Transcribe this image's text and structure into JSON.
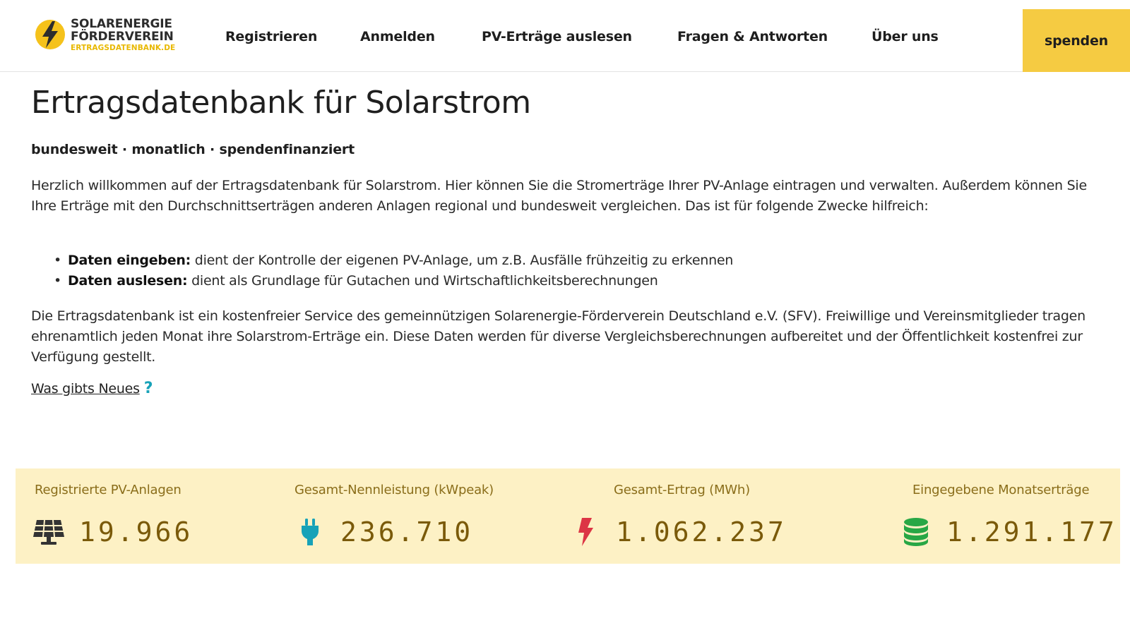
{
  "logo": {
    "line1": "SOLARENERGIE",
    "line2": "FÖRDERVEREIN",
    "line3": "ERTRAGSDATENBANK.DE",
    "icon": "sun-bolt-icon"
  },
  "nav": {
    "items": [
      {
        "label": "Registrieren"
      },
      {
        "label": "Anmelden"
      },
      {
        "label": "PV-Erträge auslesen"
      },
      {
        "label": "Fragen & Antworten"
      },
      {
        "label": "Über uns"
      }
    ],
    "donate_label": "spenden"
  },
  "main": {
    "title": "Ertragsdatenbank für Solarstrom",
    "tagline": "bundesweit · monatlich · spendenfinanziert",
    "intro": "Herzlich willkommen auf der Ertragsdatenbank für Solarstrom. Hier können Sie die Stromerträge Ihrer PV-Anlage eintragen und verwalten. Außerdem können Sie Ihre Erträge mit den Durchschnittserträgen anderen Anlagen regional und bundesweit vergleichen. Das ist für folgende Zwecke hilfreich:",
    "bullets": [
      {
        "bold": "Daten eingeben:",
        "text": " dient der Kontrolle der eigenen PV-Anlage, um z.B. Ausfälle frühzeitig zu erkennen"
      },
      {
        "bold": "Daten auslesen:",
        "text": " dient als Grundlage für Gutachen und Wirtschaftlichkeitsberechnungen"
      }
    ],
    "about": "Die Ertragsdatenbank ist ein kostenfreier Service des gemeinnützigen Solarenergie-Förderverein Deutschland e.V. (SFV). Freiwillige und Vereinsmitglieder tragen ehrenamtlich jeden Monat ihre Solarstrom-Erträge ein. Diese Daten werden für diverse Vergleichsberechnungen aufbereitet und der Öffentlichkeit kostenfrei zur Verfügung gestellt.",
    "news_link": "Was gibts Neues",
    "news_icon": "?"
  },
  "stats": [
    {
      "label": "Registrierte PV-Anlagen",
      "value": "19.966",
      "icon": "solar-panel-icon",
      "color": "#333333"
    },
    {
      "label": "Gesamt-Nennleistung (kWpeak)",
      "value": "236.710",
      "icon": "plug-icon",
      "color": "#17a2b8"
    },
    {
      "label": "Gesamt-Ertrag (MWh)",
      "value": "1.062.237",
      "icon": "lightning-bolt-icon",
      "color": "#dc3545"
    },
    {
      "label": "Eingegebene Monatserträge",
      "value": "1.291.177",
      "icon": "database-icon",
      "color": "#28a745"
    }
  ],
  "colors": {
    "accent": "#f5cb42",
    "stats_bg": "#fdf1c5",
    "stats_text": "#8a6d1a",
    "link_icon": "#17a2b8"
  }
}
